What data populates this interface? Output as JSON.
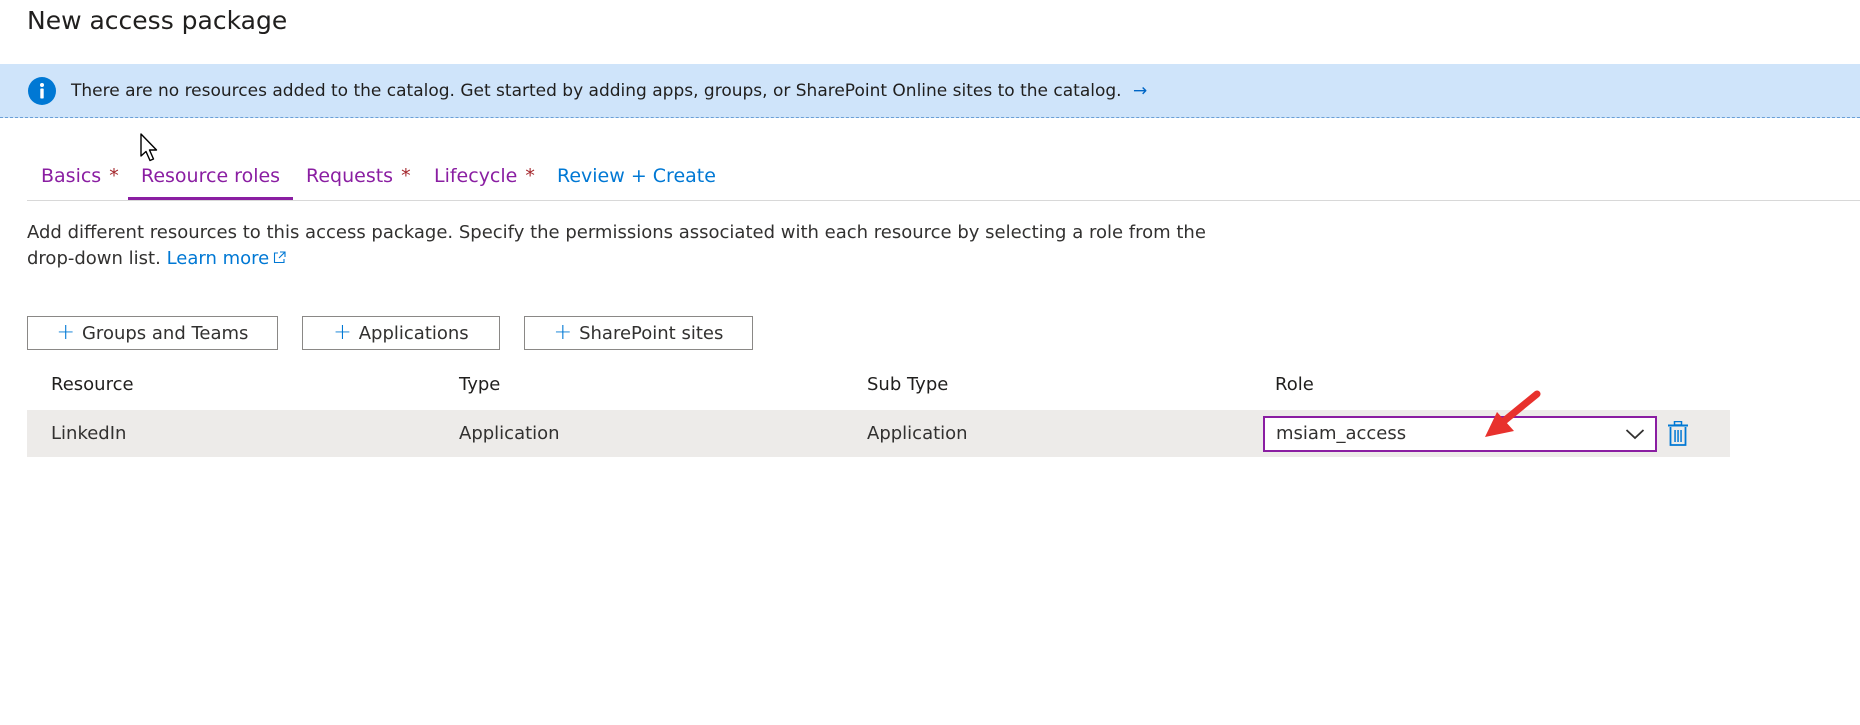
{
  "page": {
    "title": "New access package"
  },
  "banner": {
    "icon": "info-icon",
    "message": "There are no resources added to the catalog. Get started by adding apps, groups, or SharePoint Online sites to the catalog.",
    "arrow": "→"
  },
  "tabs": [
    {
      "label": "Basics",
      "required": "*"
    },
    {
      "label": "Resource roles"
    },
    {
      "label": "Requests",
      "required": "*"
    },
    {
      "label": "Lifecycle",
      "required": "*"
    },
    {
      "label": "Review + Create"
    }
  ],
  "description": {
    "text": "Add different resources to this access package. Specify the permissions associated with each resource by selecting a role from the drop-down list.",
    "link": "Learn more"
  },
  "actions": {
    "add_icon": "+",
    "groups_label": "Groups and Teams",
    "applications_label": "Applications",
    "sharepoint_label": "SharePoint sites"
  },
  "table": {
    "headers": [
      "Resource",
      "Type",
      "Sub Type",
      "Role"
    ],
    "rows": [
      {
        "resource": "LinkedIn",
        "type": "Application",
        "sub_type": "Application",
        "role": "msiam_access"
      }
    ]
  },
  "colors": {
    "accent_purple": "#8a1ea2",
    "link_blue": "#0078d4",
    "banner_bg": "#cfe4fa",
    "row_bg": "#edebe9",
    "annotation_red": "#e8312d"
  }
}
